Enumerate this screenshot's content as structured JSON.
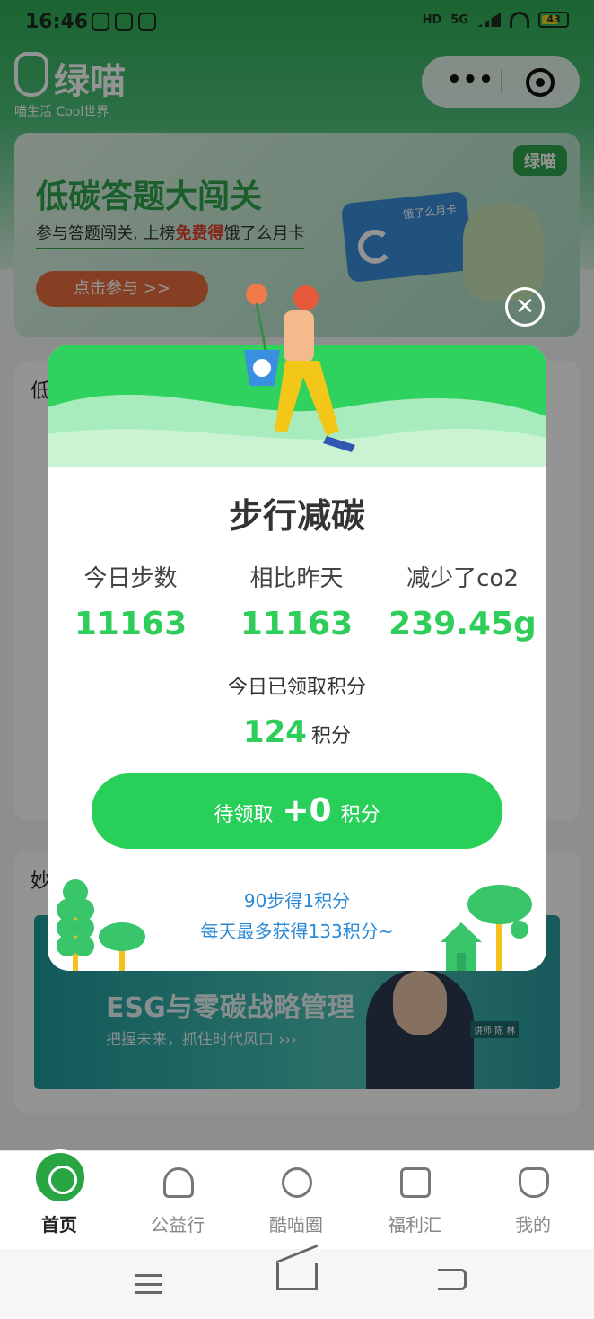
{
  "status_bar": {
    "time": "16:46",
    "network": "5G",
    "hd": "HD",
    "battery": "43"
  },
  "app": {
    "name": "绿喵",
    "tagline": "喵生活 Cool世界"
  },
  "capsule": {
    "more": "•••"
  },
  "banner": {
    "title": "低碳答题大闯关",
    "subtitle_pre": "参与答题闯关, 上榜",
    "subtitle_highlight": "免费得",
    "subtitle_post": "饿了么月卡",
    "button": "点击参与 >>",
    "badge": "绿喵",
    "card_text": "饿了么月卡"
  },
  "sections": [
    {
      "title": "低"
    },
    {
      "title": "妙"
    }
  ],
  "esg_banner": {
    "title": "ESG与零碳战略管理",
    "subtitle": "把握未来，抓住时代风口 ›››",
    "lecturer": "讲师 陈 林"
  },
  "modal": {
    "close": "✕",
    "title": "步行减碳",
    "stats": [
      {
        "label": "今日步数",
        "value": "11163"
      },
      {
        "label": "相比昨天",
        "value": "11163"
      },
      {
        "label": "减少了co2",
        "value": "239.45g"
      }
    ],
    "points_label": "今日已领取积分",
    "points_value": "124",
    "points_unit": "积分",
    "claim": {
      "prefix": "待领取",
      "value": "+0",
      "suffix": "积分"
    },
    "rule_1": "90步得1积分",
    "rule_2": "每天最多获得133积分~"
  },
  "tabbar": [
    {
      "label": "首页",
      "icon": "home-cat-icon",
      "active": true
    },
    {
      "label": "公益行",
      "icon": "heart-icon",
      "active": false
    },
    {
      "label": "酷喵圈",
      "icon": "cat-face-icon",
      "active": false
    },
    {
      "label": "福利汇",
      "icon": "shop-icon",
      "active": false
    },
    {
      "label": "我的",
      "icon": "smile-icon",
      "active": false
    }
  ],
  "colors": {
    "brand_green": "#2fcd5a",
    "rule_blue": "#2a89d6",
    "banner_orange": "#e86d3d"
  }
}
